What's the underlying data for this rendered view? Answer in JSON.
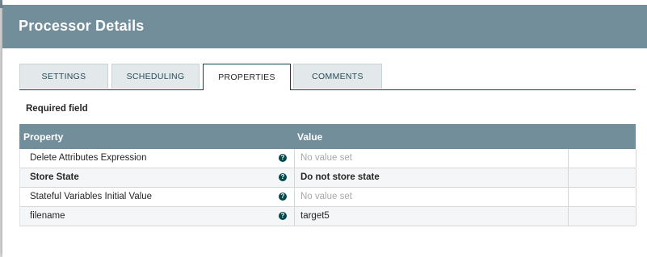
{
  "dialog": {
    "title": "Processor Details"
  },
  "tabs": [
    {
      "label": "SETTINGS",
      "active": false
    },
    {
      "label": "SCHEDULING",
      "active": false
    },
    {
      "label": "PROPERTIES",
      "active": true
    },
    {
      "label": "COMMENTS",
      "active": false
    }
  ],
  "required_label": "Required field",
  "grid": {
    "columns": {
      "property": "Property",
      "value": "Value"
    },
    "rows": [
      {
        "property": "Delete Attributes Expression",
        "value": "No value set",
        "required": false,
        "value_set": false
      },
      {
        "property": "Store State",
        "value": "Do not store state",
        "required": true,
        "value_set": true
      },
      {
        "property": "Stateful Variables Initial Value",
        "value": "No value set",
        "required": false,
        "value_set": false
      },
      {
        "property": "filename",
        "value": "target5",
        "required": false,
        "value_set": true
      }
    ]
  },
  "icons": {
    "help": "question-circle-icon"
  },
  "colors": {
    "header_bg": "#728e9b",
    "accent": "#004849",
    "unset_value": "#a8a8a8"
  }
}
